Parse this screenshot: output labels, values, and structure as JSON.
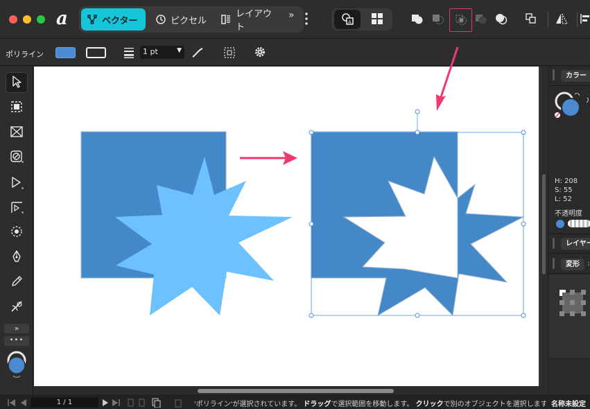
{
  "personas": [
    {
      "label": "ベクター",
      "icon": "vector-persona-icon",
      "active": true
    },
    {
      "label": "ピクセル",
      "icon": "pixel-persona-icon",
      "active": false
    },
    {
      "label": "レイアウト",
      "icon": "layout-persona-icon",
      "active": false
    }
  ],
  "context_toolbar": {
    "tool_label": "ポリライン",
    "stroke_width": "1 pt",
    "fill_color": "#4a8ad0"
  },
  "canvas": {
    "shapes": {
      "square_color": "#4588c8",
      "star_color": "#6ec1ff",
      "selection_color": "#4a90e2",
      "arrow_color": "#f1386e"
    }
  },
  "color_panel": {
    "tab_label": "カラー",
    "h": "H: 208",
    "s": "S: 55",
    "l": "L: 52",
    "opacity_label": "不透明度",
    "current_color": "#4a8ad0"
  },
  "layers_panel": {
    "tab_label": "レイヤー"
  },
  "transform_panel": {
    "tab_label": "変形"
  },
  "statusbar": {
    "page": "1 / 1",
    "message_prefix": "'ポリライン'が選択されています。",
    "drag_key": "ドラッグ",
    "drag_text": "で選択範囲を移動します。",
    "click_key": "クリック",
    "click_text": "で別のオブジェクトを選択します",
    "doc_name": "名称未設定"
  }
}
